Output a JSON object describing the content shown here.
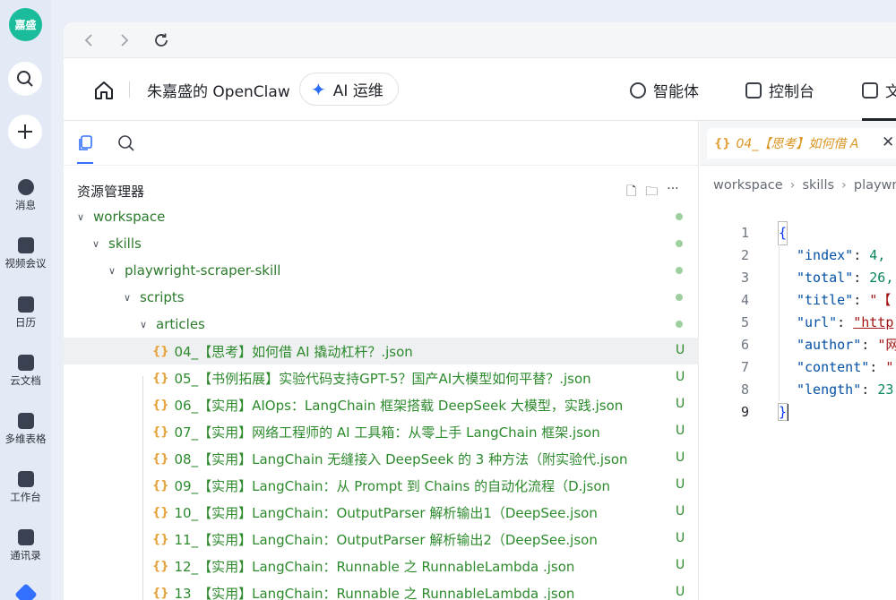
{
  "rail": {
    "avatar_text": "嘉盛",
    "items": [
      {
        "label": "消息",
        "icon": "chat-icon"
      },
      {
        "label": "视频会议",
        "icon": "video-icon"
      },
      {
        "label": "日历",
        "icon": "calendar-icon"
      },
      {
        "label": "云文档",
        "icon": "document-icon"
      },
      {
        "label": "多维表格",
        "icon": "table-icon"
      },
      {
        "label": "工作台",
        "icon": "apps-icon"
      },
      {
        "label": "通讯录",
        "icon": "contacts-icon"
      }
    ]
  },
  "header": {
    "app_title": "朱嘉盛的 OpenClaw",
    "ai_label": "AI 运维",
    "tabs": [
      {
        "label": "智能体",
        "icon": "agent-icon"
      },
      {
        "label": "控制台",
        "icon": "console-icon"
      },
      {
        "label": "文",
        "icon": "folder-icon"
      }
    ]
  },
  "explorer": {
    "title": "资源管理器",
    "folders": [
      {
        "label": "workspace"
      },
      {
        "label": "skills"
      },
      {
        "label": "playwright-scraper-skill"
      },
      {
        "label": "scripts"
      },
      {
        "label": "articles"
      }
    ],
    "files": [
      {
        "label": "04_【思考】如何借 AI 撬动杠杆？.json",
        "status": "U"
      },
      {
        "label": "05_【书例拓展】实验代码支持GPT-5？国产AI大模型如何平替？.json",
        "status": "U"
      },
      {
        "label": "06_【实用】AIOps：LangChain 框架搭载 DeepSeek 大模型，实践.json",
        "status": "U"
      },
      {
        "label": "07_【实用】网络工程师的 AI 工具箱：从零上手 LangChain 框架.json",
        "status": "U"
      },
      {
        "label": "08_【实用】LangChain 无缝接入 DeepSeek 的 3 种方法（附实验代.json",
        "status": "U"
      },
      {
        "label": "09_【实用】LangChain：从 Prompt 到 Chains 的自动化流程（D.json",
        "status": "U"
      },
      {
        "label": "10_【实用】LangChain：OutputParser 解析输出1（DeepSee.json",
        "status": "U"
      },
      {
        "label": "11_【实用】LangChain：OutputParser 解析输出2（DeepSee.json",
        "status": "U"
      },
      {
        "label": "12_【实用】LangChain：Runnable 之 RunnableLambda .json",
        "status": "U"
      },
      {
        "label": "13_【实用】LangChain：Runnable 之 RunnableLambda .json",
        "status": "U"
      }
    ]
  },
  "editor": {
    "tab_label": "04_【思考】如何借 A",
    "breadcrumb": [
      "workspace",
      "skills",
      "playwri"
    ],
    "code": {
      "open": "{",
      "close": "}",
      "lines": [
        {
          "key": "\"index\"",
          "value": "4,",
          "type": "n"
        },
        {
          "key": "\"total\"",
          "value": "26,",
          "type": "n"
        },
        {
          "key": "\"title\"",
          "value": "\"【",
          "type": "s"
        },
        {
          "key": "\"url\"",
          "value": "\"http",
          "type": "s"
        },
        {
          "key": "\"author\"",
          "value": "\"网",
          "type": "s"
        },
        {
          "key": "\"content\"",
          "value": "\"",
          "type": "s"
        },
        {
          "key": "\"length\"",
          "value": "23",
          "type": "n"
        }
      ],
      "line_numbers": [
        "1",
        "2",
        "3",
        "4",
        "5",
        "6",
        "7",
        "8",
        "9"
      ]
    }
  }
}
